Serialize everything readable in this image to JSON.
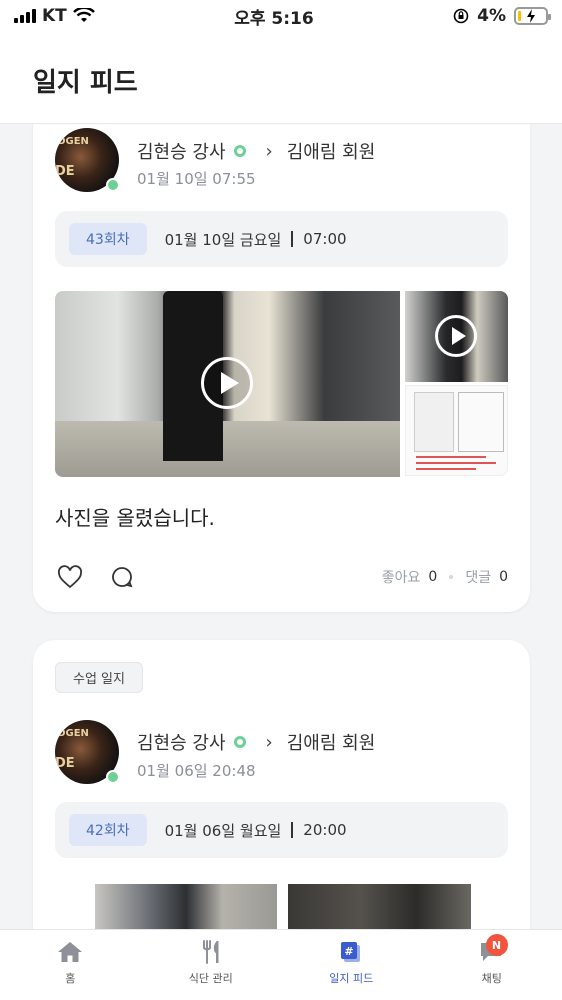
{
  "status_bar": {
    "carrier": "KT",
    "time": "오후 5:16",
    "battery_percent": "4%"
  },
  "header": {
    "title": "일지 피드"
  },
  "posts": [
    {
      "author": "김현승 강사",
      "recipient": "김애림 회원",
      "datetime": "01월 10일 07:55",
      "session_badge": "43회차",
      "session_date": "01월 10일 금요일",
      "session_time": "07:00",
      "text": "사진을 올렸습니다.",
      "likes_label": "좋아요",
      "likes_count": "0",
      "comments_label": "댓글",
      "comments_count": "0"
    },
    {
      "tag": "수업 일지",
      "author": "김현승 강사",
      "recipient": "김애림 회원",
      "datetime": "01월 06일 20:48",
      "session_badge": "42회차",
      "session_date": "01월 06일 월요일",
      "session_time": "20:00"
    }
  ],
  "avatar": {
    "text_top": "OGEN",
    "text_bottom": "DE"
  },
  "tabbar": {
    "items": [
      {
        "label": "홈",
        "icon": "home-icon"
      },
      {
        "label": "식단 관리",
        "icon": "fork-knife-icon"
      },
      {
        "label": "일지 피드",
        "icon": "feed-hash-icon"
      },
      {
        "label": "채팅",
        "icon": "chat-icon"
      }
    ],
    "active_index": 2,
    "chat_badge": "N"
  },
  "colors": {
    "accent": "#3b5bd0",
    "online": "#6ed095",
    "badge": "#f2553d",
    "session_badge_bg": "#dfe6f7"
  }
}
